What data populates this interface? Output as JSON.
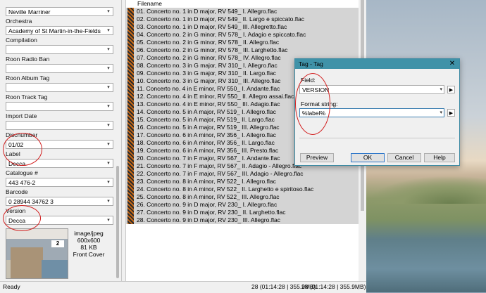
{
  "left_panel": {
    "conductor_value": "Neville Marriner",
    "fields": [
      {
        "label": "Orchestra",
        "value": "Academy of St Martin-in-the-Fields"
      },
      {
        "label": "Compilation",
        "value": ""
      },
      {
        "label": "Roon Radio Ban",
        "value": ""
      },
      {
        "label": "Roon Album Tag",
        "value": ""
      },
      {
        "label": "Roon Track Tag",
        "value": ""
      },
      {
        "label": "Import Date",
        "value": ""
      },
      {
        "label": "Discnumber",
        "value": "01/02"
      },
      {
        "label": "Label",
        "value": "Decca"
      },
      {
        "label": "Catalogue #",
        "value": "443 476-2"
      },
      {
        "label": "Barcode",
        "value": "0 28944 34762 3"
      },
      {
        "label": "Version",
        "value": "Decca"
      }
    ],
    "cover": {
      "type": "image/jpeg",
      "dimensions": "600x600",
      "size": "81 KB",
      "kind": "Front Cover"
    }
  },
  "file_list": {
    "header": "Filename",
    "rows": [
      "01. Concerto no. 1 in D major, RV 549_ I. Allegro.flac",
      "02. Concerto no. 1 in D major, RV 549_ II. Largo e spiccato.flac",
      "03. Concerto no. 1 in D major, RV 549_ III. Allegretto.flac",
      "04. Concerto no. 2 in G minor, RV 578_ I. Adagio e spiccato.flac",
      "05. Concerto no. 2 in G minor, RV 578_ II. Allegro.flac",
      "06. Concerto no. 2 in G minor, RV 578_ III. Larghetto.flac",
      "07. Concerto no. 2 in G minor, RV 578_ IV. Allegro.flac",
      "08. Concerto no. 3 in G major, RV 310_ I. Allegro.flac",
      "09. Concerto no. 3 in G major, RV 310_ II. Largo.flac",
      "10. Concerto no. 3 in G major, RV 310_ III. Allegro.flac",
      "11. Concerto no. 4 in E minor, RV 550_ I. Andante.flac",
      "12. Concerto no. 4 in E minor, RV 550_ II. Allegro assai.flac",
      "13. Concerto no. 4 in E minor, RV 550_ III. Adagio.flac",
      "14. Concerto no. 5 in A major, RV 519_ I. Allegro.flac",
      "15. Concerto no. 5 in A major, RV 519_ II. Largo.flac",
      "16. Concerto no. 5 in A major, RV 519_ III. Allegro.flac",
      "17. Concerto no. 6 in A minor, RV 356_ I. Allegro.flac",
      "18. Concerto no. 6 in A minor, RV 356_ II. Largo.flac",
      "19. Concerto no. 6 in A minor, RV 356_ III. Presto.flac",
      "20. Concerto no. 7 in F major, RV 567_ I. Andante.flac",
      "21. Concerto no. 7 in F major, RV 567_ II. Adagio - Allegro.flac",
      "22. Concerto no. 7 in F major, RV 567_ III. Adagio - Allegro.flac",
      "23. Concerto no. 8 in A minor, RV 522_ I. Allegro.flac",
      "24. Concerto no. 8 in A minor, RV 522_ II. Larghetto e spiritoso.flac",
      "25. Concerto no. 8 in A minor, RV 522_ III. Allegro.flac",
      "26. Concerto no. 9 in D major, RV 230_ I. Allegro.flac",
      "27. Concerto no. 9 in D major, RV 230_ II. Larghetto.flac",
      "28. Concerto no. 9 in D major, RV 230_ III. Allegro.flac"
    ]
  },
  "status_bar": {
    "ready": "Ready",
    "selection": "28 (01:14:28 | 355.9MB)",
    "total": "28 (01:14:28 | 355.9MB)"
  },
  "dialog": {
    "title": "Tag - Tag",
    "close_glyph": "✕",
    "field_label": "Field:",
    "field_value": "VERSION",
    "format_label": "Format string:",
    "format_value": "%label%",
    "buttons": {
      "preview": "Preview",
      "ok": "OK",
      "cancel": "Cancel",
      "help": "Help"
    }
  },
  "colors": {
    "annotation": "#d21e1e",
    "dialog_title": "#3f92a8"
  }
}
